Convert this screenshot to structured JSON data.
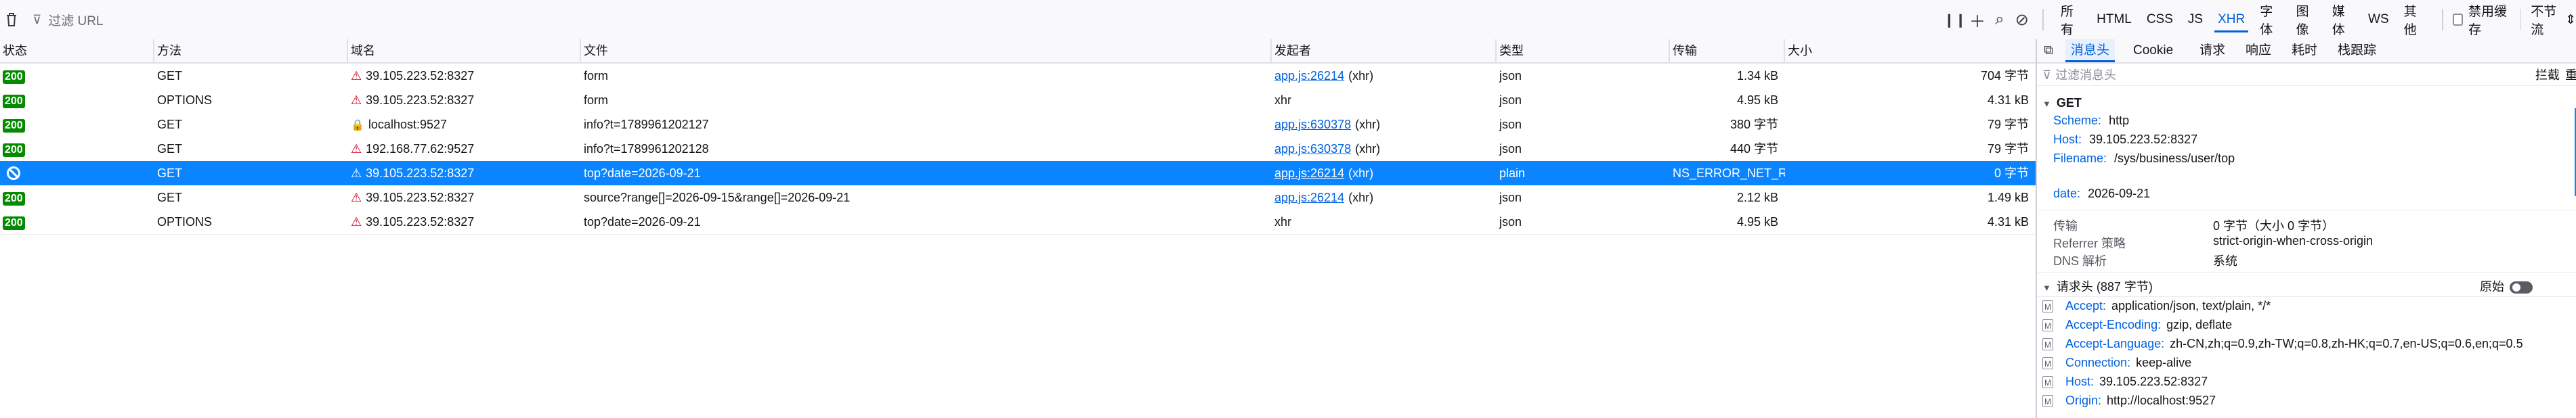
{
  "toolbar": {
    "filter_placeholder": "过滤 URL",
    "type_filters": [
      "所有",
      "HTML",
      "CSS",
      "JS",
      "XHR",
      "字体",
      "图像",
      "媒体",
      "WS",
      "其他"
    ],
    "active_type": "XHR",
    "disable_cache_label": "禁用缓存",
    "throttle_label": "不节流",
    "throttle_arrow": "⇕"
  },
  "columns": [
    "状态",
    "方法",
    "域名",
    "文件",
    "发起者",
    "类型",
    "传输",
    "大小"
  ],
  "requests": [
    {
      "status": "200",
      "method": "GET",
      "domain": "39.105.223.52:8327",
      "file": "form",
      "initiator_link": "app.js:26214",
      "initiator_rest": "(xhr)",
      "type": "json",
      "transfer": "1.34 kB",
      "size": "704 字节",
      "secure": false,
      "selected": false,
      "blocked": false
    },
    {
      "status": "200",
      "method": "OPTIONS",
      "domain": "39.105.223.52:8327",
      "file": "form",
      "initiator_link": "",
      "initiator_rest": "xhr",
      "type": "json",
      "transfer": "4.95 kB",
      "size": "4.31 kB",
      "secure": false,
      "selected": false,
      "blocked": false
    },
    {
      "status": "200",
      "method": "GET",
      "domain": "localhost:9527",
      "file": "info?t=1789961202127",
      "initiator_link": "app.js:630378",
      "initiator_rest": "(xhr)",
      "type": "json",
      "transfer": "380 字节",
      "size": "79 字节",
      "secure": true,
      "selected": false,
      "blocked": false
    },
    {
      "status": "200",
      "method": "GET",
      "domain": "192.168.77.62:9527",
      "file": "info?t=1789961202128",
      "initiator_link": "app.js:630378",
      "initiator_rest": "(xhr)",
      "type": "json",
      "transfer": "440 字节",
      "size": "79 字节",
      "secure": false,
      "selected": false,
      "blocked": false
    },
    {
      "status": "",
      "method": "GET",
      "domain": "39.105.223.52:8327",
      "file": "top?date=2026-09-21",
      "initiator_link": "app.js:26214",
      "initiator_rest": "(xhr)",
      "type": "plain",
      "transfer": "NS_ERROR_NET_R...",
      "size": "0 字节",
      "secure": false,
      "selected": true,
      "blocked": true
    },
    {
      "status": "200",
      "method": "GET",
      "domain": "39.105.223.52:8327",
      "file": "source?range[]=2026-09-15&range[]=2026-09-21",
      "initiator_link": "app.js:26214",
      "initiator_rest": "(xhr)",
      "type": "json",
      "transfer": "2.12 kB",
      "size": "1.49 kB",
      "secure": false,
      "selected": false,
      "blocked": false
    },
    {
      "status": "200",
      "method": "OPTIONS",
      "domain": "39.105.223.52:8327",
      "file": "top?date=2026-09-21",
      "initiator_link": "",
      "initiator_rest": "xhr",
      "type": "json",
      "transfer": "4.95 kB",
      "size": "4.31 kB",
      "secure": false,
      "selected": false,
      "blocked": false
    }
  ],
  "sidebar": {
    "tabs": [
      "消息头",
      "Cookie",
      "请求",
      "响应",
      "耗时",
      "栈跟踪"
    ],
    "active_tab": "消息头",
    "filter_placeholder": "过滤消息头",
    "block_label": "拦截",
    "resend_label": "重",
    "general": {
      "method": "GET",
      "scheme_key": "Scheme:",
      "scheme_val": "http",
      "host_key": "Host:",
      "host_val": "39.105.223.52:8327",
      "filename_key": "Filename:",
      "filename_val": "/sys/business/user/top",
      "date_key": "date:",
      "date_val": "2026-09-21"
    },
    "meta": [
      {
        "key": "传输",
        "val": "0 字节（大小 0 字节）"
      },
      {
        "key": "Referrer 策略",
        "val": "strict-origin-when-cross-origin"
      },
      {
        "key": "DNS 解析",
        "val": "系统"
      }
    ],
    "request_headers_title": "请求头 (887 字节)",
    "raw_label": "原始",
    "headers": [
      {
        "key": "Accept:",
        "val": "application/json, text/plain, */*"
      },
      {
        "key": "Accept-Encoding:",
        "val": "gzip, deflate"
      },
      {
        "key": "Accept-Language:",
        "val": "zh-CN,zh;q=0.9,zh-TW;q=0.8,zh-HK;q=0.7,en-US;q=0.6,en;q=0.5"
      },
      {
        "key": "Connection:",
        "val": "keep-alive"
      },
      {
        "key": "Host:",
        "val": "39.105.223.52:8327"
      },
      {
        "key": "Origin:",
        "val": "http://localhost:9527"
      }
    ]
  }
}
